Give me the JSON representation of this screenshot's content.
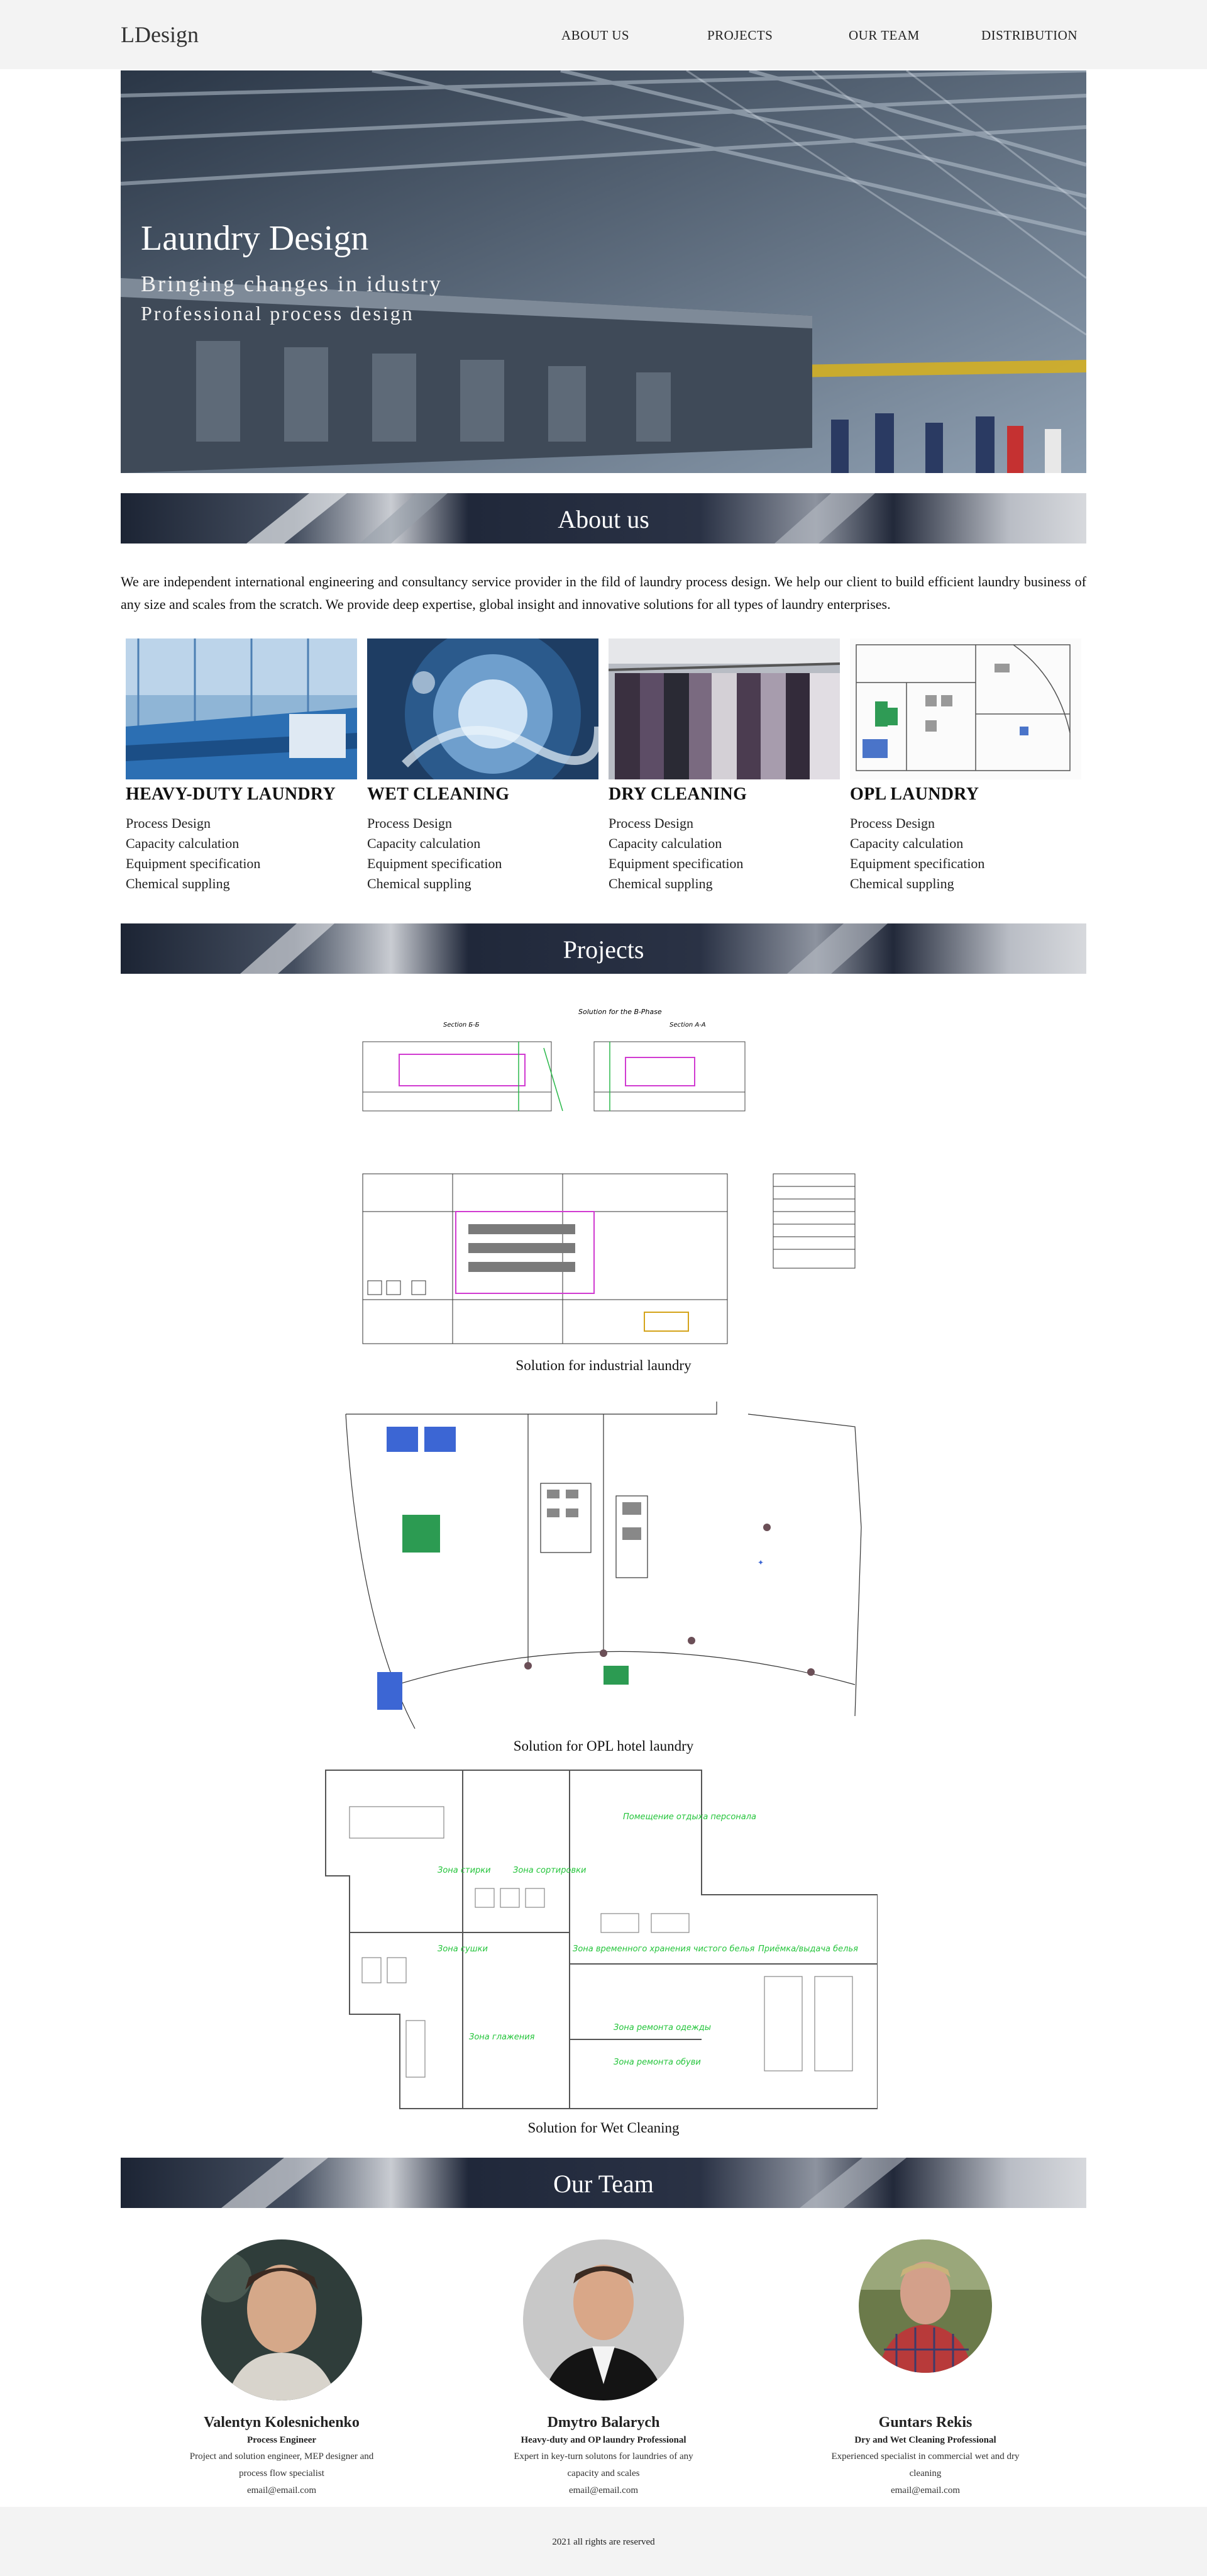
{
  "nav": {
    "brand": "LDesign",
    "links": [
      "ABOUT US",
      "PROJECTS",
      "OUR TEAM",
      "DISTRIBUTION"
    ]
  },
  "hero": {
    "title": "Laundry Design",
    "line1": "Bringing changes in idustry",
    "line2": "Professional process design"
  },
  "about": {
    "heading": "About us",
    "text": "We are independent international engineering and consultancy service provider in the fild of laundry process design. We help our client to build efficient laundry business of any size and scales from the scratch. We provide deep expertise, global insight and innovative solutions for all types of laundry enterprises."
  },
  "services": [
    {
      "title": "HEAVY-DUTY LAUNDRY",
      "items": [
        "Process Design",
        "Capacity calculation",
        "Equipment specification",
        "Chemical suppling"
      ]
    },
    {
      "title": "WET CLEANING",
      "items": [
        "Process Design",
        "Capacity calculation",
        "Equipment specification",
        "Chemical suppling"
      ]
    },
    {
      "title": "DRY CLEANING",
      "items": [
        "Process Design",
        "Capacity calculation",
        "Equipment specification",
        "Chemical suppling"
      ]
    },
    {
      "title": "OPL LAUNDRY",
      "items": [
        "Process Design",
        "Capacity calculation",
        "Equipment specification",
        "Chemical suppling"
      ]
    }
  ],
  "projects": {
    "heading": "Projects",
    "items": [
      {
        "caption": "Solution for industrial laundry",
        "drawing_label": "Solution for the B-Phase",
        "section_left": "Section Б-Б",
        "section_right": "Section A-A"
      },
      {
        "caption": "Solution for OPL hotel laundry"
      },
      {
        "caption": "Solution for Wet Cleaning",
        "zones": [
          "Помещение отдыха персонала",
          "Зона стирки",
          "Зона сортировки",
          "Зона сушки",
          "Зона временного хранения чистого белья",
          "Приёмка/выдача белья",
          "Зона глажения",
          "Зона ремонта одежды",
          "Зона ремонта обуви"
        ]
      }
    ]
  },
  "team": {
    "heading": "Our Team",
    "members": [
      {
        "name": "Valentyn Kolesnichenko",
        "role": "Process Engineer",
        "bio": "Project and solution engineer, MEP designer and process flow specialist",
        "email": "email@email.com"
      },
      {
        "name": "Dmytro Balarych",
        "role": "Heavy-duty and OP laundry Professional",
        "bio": "Expert in key-turn solutons for laundries of any capacity and scales",
        "email": "email@email.com"
      },
      {
        "name": "Guntars Rekis",
        "role": "Dry and Wet Cleaning Professional",
        "bio": "Experienced specialist in commercial wet and dry cleaning",
        "email": "email@email.com"
      }
    ]
  },
  "footer": {
    "text": "2021 all rights are reserved"
  }
}
